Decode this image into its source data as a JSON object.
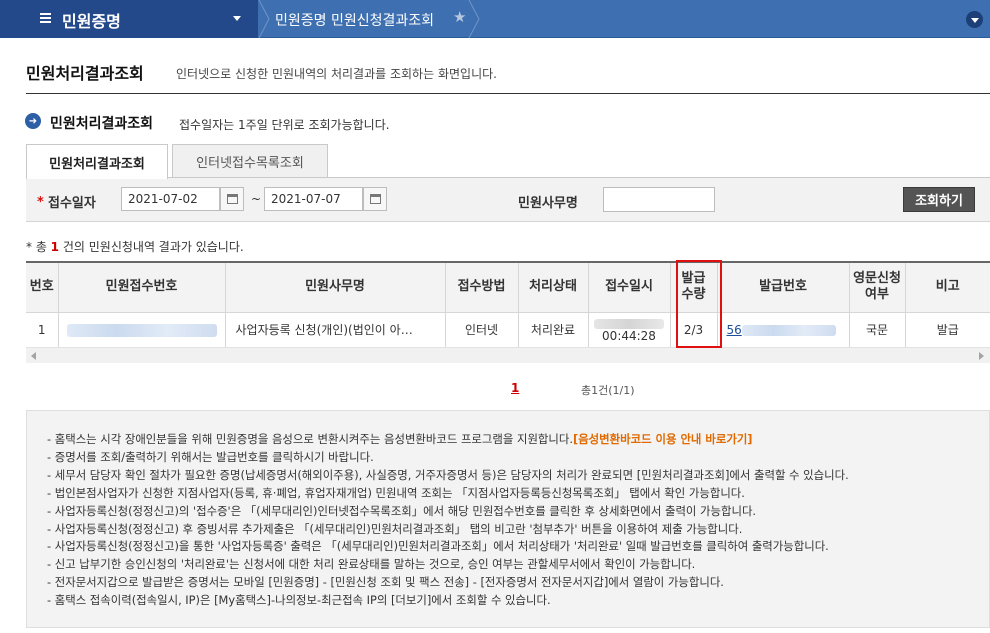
{
  "header": {
    "menu_title": "민원증명",
    "breadcrumb": "민원증명 민원신청결과조회"
  },
  "page": {
    "title": "민원처리결과조회",
    "description": "인터넷으로 신청한 민원내역의 처리결과를 조회하는 화면입니다."
  },
  "section": {
    "title": "민원처리결과조회",
    "description": "접수일자는 1주일 단위로 조회가능합니다."
  },
  "tabs": [
    {
      "label": "민원처리결과조회",
      "active": true
    },
    {
      "label": "인터넷접수목록조회",
      "active": false
    }
  ],
  "search": {
    "date_label": "접수일자",
    "date_from": "2021-07-02",
    "date_sep": "~",
    "date_to": "2021-07-07",
    "name_label": "민원사무명",
    "name_value": "",
    "button_label": "조회하기"
  },
  "result": {
    "prefix": "* 총 ",
    "count": "1",
    "suffix": " 건의 민원신청내역 결과가 있습니다."
  },
  "table": {
    "headers": [
      "번호",
      "민원접수번호",
      "민원사무명",
      "접수방법",
      "처리상태",
      "접수일시",
      "발급\n수량",
      "발급번호",
      "영문신청\n여부",
      "비고"
    ],
    "rows": [
      {
        "no": "1",
        "receipt_no": "",
        "name": "사업자등록 신청(개인)(법인이 아…",
        "method": "인터넷",
        "status": "처리완료",
        "time": "00:44:28",
        "qty": "2/3",
        "issue_no": "56",
        "english": "국문",
        "remark": "발급"
      }
    ]
  },
  "pager": {
    "current": "1",
    "total": "총1건(1/1)"
  },
  "notice": {
    "items": [
      "- 홈택스는 시각 장애인분들을 위해 민원증명을 음성으로 변환시켜주는 음성변환바코드 프로그램을 지원합니다.",
      "- 증명서를 조회/출력하기 위해서는 발급번호를 클릭하시기 바랍니다.",
      "- 세무서 담당자 확인 절차가 필요한 증명(납세증명서(해외이주용), 사실증명, 거주자증명서 등)은 담당자의 처리가 완료되면 [민원처리결과조회]에서 출력할 수 있습니다.",
      "- 법인본점사업자가 신청한 지점사업자(등록, 휴·폐업, 휴업자재개업) 민원내역 조회는 「지점사업자등록등신청목록조회」 탭에서 확인 가능합니다.",
      "- 사업자등록신청(정정신고)의 '접수증'은 「(세무대리인)인터넷접수목록조회」에서 해당 민원접수번호를 클릭한 후 상세화면에서 출력이 가능합니다.",
      "- 사업자등록신청(정정신고) 후 증빙서류 추가제출은 「(세무대리인)민원처리결과조회」 탭의 비고란 '첨부추가' 버튼을 이용하여 제출 가능합니다.",
      "- 사업자등록신청(정정신고)을 통한 '사업자등록증' 출력은  「(세무대리인)민원처리결과조회」에서 처리상태가 '처리완료' 일때 발급번호를 클릭하여 출력가능합니다.",
      "- 신고 납부기한 승인신청의 '처리완료'는 신청서에 대한 처리 완료상태를 말하는 것으로, 승인 여부는 관할세무서에서 확인이 가능합니다.",
      "- 전자문서지갑으로 발급받은 증명서는 모바일 [민원증명] - [민원신청 조회 및 팩스 전송] - [전자증명서 전자문서지갑]에서 열람이 가능합니다.",
      "- 홈택스 접속이력(접속일시, IP)은 [My홈택스]-나의정보-최근접속 IP의 [더보기]에서 조회할 수 있습니다."
    ],
    "first_link": "[음성변환바코드 이용 안내 바로가기]"
  }
}
